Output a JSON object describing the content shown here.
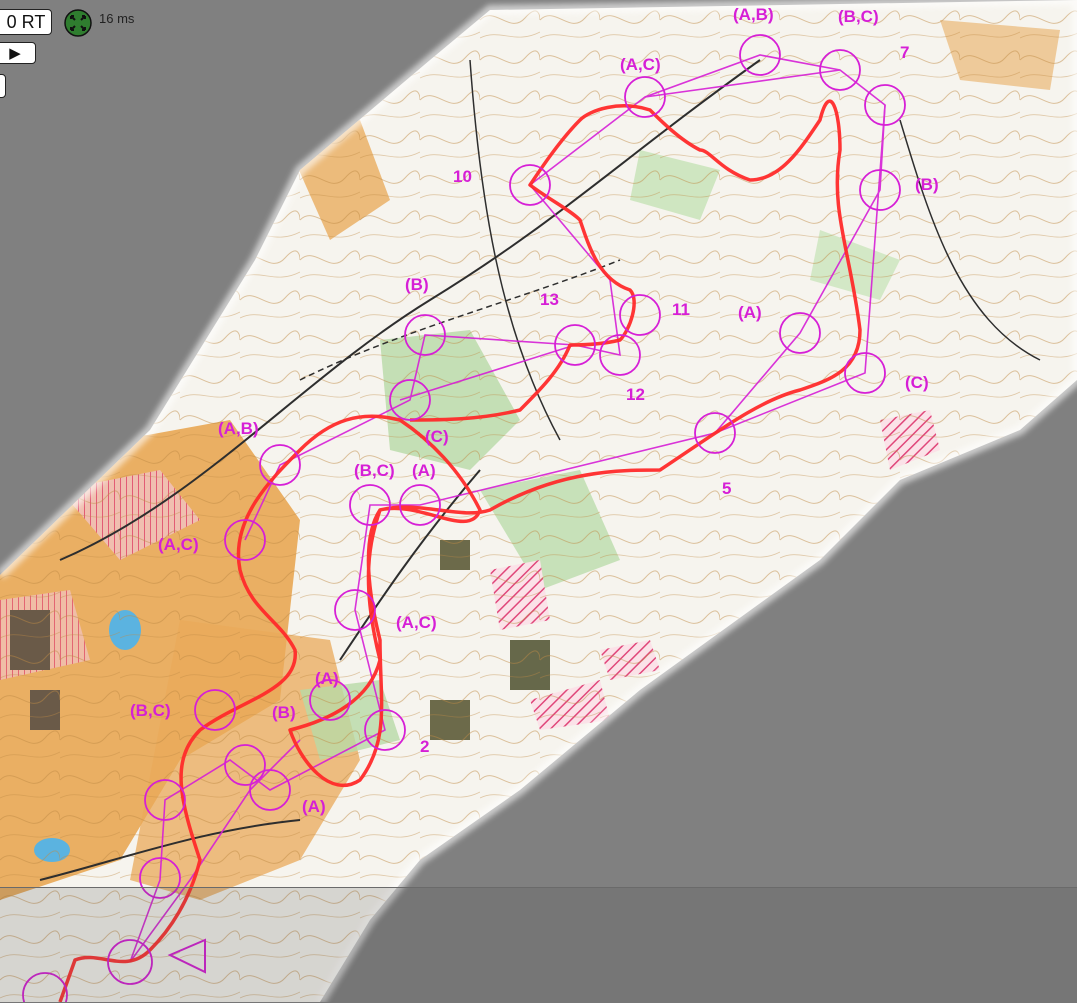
{
  "toolbar": {
    "rt_label": "0 RT",
    "play_symbol": "▶",
    "latency": "16 ms",
    "zoom_icon": "recenter-icon"
  },
  "colors": {
    "background": "#808080",
    "course_magenta": "#d61fd6",
    "route_red": "#ff2a2a",
    "terrain_white": "#f6f4ee",
    "terrain_orange": "#e8a24a",
    "terrain_green": "#b8d9a6",
    "contour_brown": "#b8742a"
  },
  "controls": [
    {
      "label": "(A,B)"
    },
    {
      "label": "(B,C)"
    },
    {
      "label": "7"
    },
    {
      "label": "(A,C)"
    },
    {
      "label": "10"
    },
    {
      "label": "(B)"
    },
    {
      "label": "(B)"
    },
    {
      "label": "13"
    },
    {
      "label": "11"
    },
    {
      "label": "(A)"
    },
    {
      "label": "12"
    },
    {
      "label": "(C)"
    },
    {
      "label": "(C)"
    },
    {
      "label": "(A,B)"
    },
    {
      "label": "(B,C)"
    },
    {
      "label": "(A)"
    },
    {
      "label": "5"
    },
    {
      "label": "(A,C)"
    },
    {
      "label": "(A,C)"
    },
    {
      "label": "(A)"
    },
    {
      "label": "(B,C)"
    },
    {
      "label": "(B)"
    },
    {
      "label": "2"
    },
    {
      "label": "(A)"
    }
  ]
}
